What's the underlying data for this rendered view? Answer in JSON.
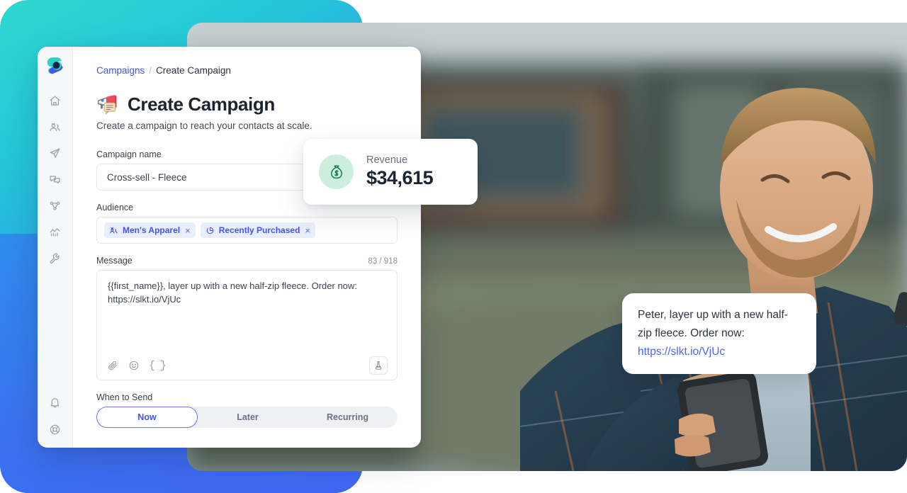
{
  "brand": {
    "logo_name": "slkt-logo",
    "accent": "#4355e8",
    "gradient_from": "#2fd8d0",
    "gradient_to": "#3f66f2"
  },
  "sidebar": {
    "items": [
      {
        "icon": "home-icon",
        "label": "Home"
      },
      {
        "icon": "contacts-icon",
        "label": "Contacts"
      },
      {
        "icon": "campaigns-send-icon",
        "label": "Campaigns"
      },
      {
        "icon": "conversations-icon",
        "label": "Conversations"
      },
      {
        "icon": "automations-icon",
        "label": "Automations"
      },
      {
        "icon": "analytics-icon",
        "label": "Analytics"
      },
      {
        "icon": "settings-wrench-icon",
        "label": "Settings"
      }
    ],
    "bottom_items": [
      {
        "icon": "bell-icon",
        "label": "Notifications"
      },
      {
        "icon": "help-icon",
        "label": "Help"
      }
    ]
  },
  "breadcrumb": {
    "parent": "Campaigns",
    "separator": "/",
    "current": "Create Campaign"
  },
  "page": {
    "emoji": "megaphone-speech-emoji",
    "title": "Create Campaign",
    "subtitle": "Create a campaign to reach your contacts at scale."
  },
  "form": {
    "campaign_name": {
      "label": "Campaign name",
      "value": "Cross-sell - Fleece",
      "placeholder": "Campaign name"
    },
    "audience": {
      "label": "Audience",
      "tags": [
        {
          "icon": "audience-group-icon",
          "label": "Men's Apparel",
          "remove": "×"
        },
        {
          "icon": "recently-purchased-icon",
          "label": "Recently Purchased",
          "remove": "×"
        }
      ]
    },
    "message": {
      "label": "Message",
      "char_count": "83 / 918",
      "value": "{{first_name}}, layer up with a new half-zip fleece. Order now: https://slkt.io/VjUc",
      "toolbar": [
        {
          "icon": "attachment-icon",
          "label": "Attach file"
        },
        {
          "icon": "emoji-icon",
          "label": "Insert emoji"
        },
        {
          "icon": "merge-field-icon",
          "label": "{ }"
        }
      ],
      "test_button": {
        "icon": "flask-icon",
        "label": "Test message"
      }
    },
    "when_to_send": {
      "label": "When to Send",
      "options": [
        "Now",
        "Later",
        "Recurring"
      ],
      "selected": "Now"
    }
  },
  "revenue_card": {
    "icon": "money-bag-icon",
    "label": "Revenue",
    "value": "$34,615",
    "icon_color": "#17795c",
    "icon_bg": "#cdeedd"
  },
  "sms_preview": {
    "text": "Peter, layer up with a new half-zip fleece. Order now:",
    "link": "https://slkt.io/VjUc"
  },
  "photo": {
    "alt": "smiling-man-with-phone-outdoors"
  }
}
